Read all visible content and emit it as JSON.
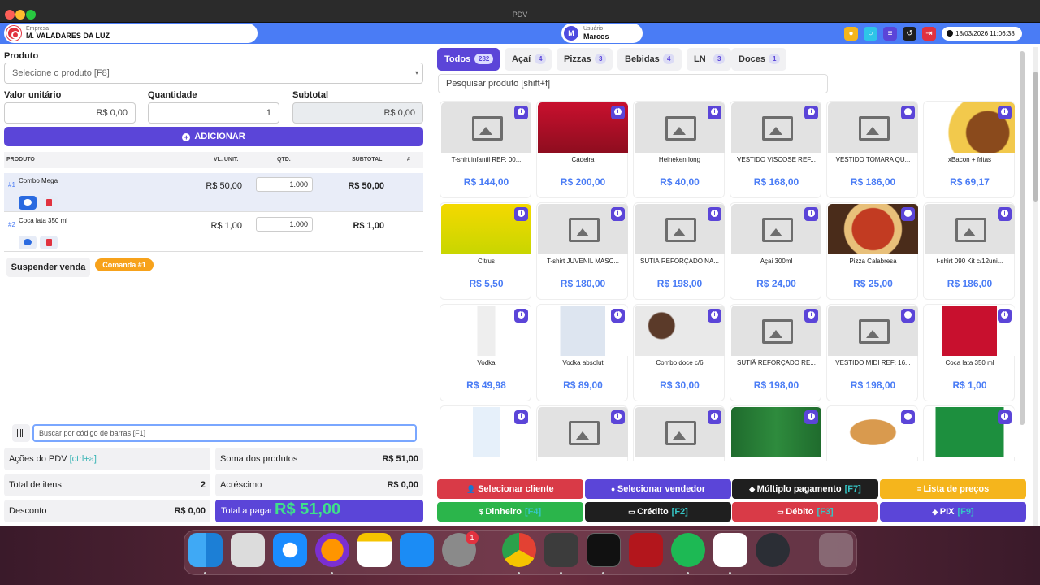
{
  "window": {
    "title": "PDV"
  },
  "header": {
    "empresa_label": "Empresa",
    "empresa_name": "M. VALADARES DA LUZ",
    "usuario_label": "Usuário",
    "usuario_name": "Marcos",
    "usuario_initial": "M",
    "datetime": "18/03/2026 11:06:38"
  },
  "form": {
    "produto_label": "Produto",
    "produto_placeholder": "Selecione o produto [F8]",
    "valor_label": "Valor unitário",
    "valor_value": "R$ 0,00",
    "qtd_label": "Quantidade",
    "qtd_value": "1",
    "subtotal_label": "Subtotal",
    "subtotal_value": "R$ 0,00",
    "add_label": "ADICIONAR"
  },
  "table": {
    "headers": [
      "PRODUTO",
      "VL. UNIT.",
      "QTD.",
      "SUBTOTAL",
      "#"
    ],
    "rows": [
      {
        "num": "#1",
        "name": "Combo Mega",
        "price": "R$ 50,00",
        "qty": "1.000",
        "subtotal": "R$ 50,00"
      },
      {
        "num": "#2",
        "name": "Coca lata 350 ml",
        "price": "R$ 1,00",
        "qty": "1.000",
        "subtotal": "R$ 1,00"
      }
    ]
  },
  "suspend_label": "Suspender venda",
  "comanda_label": "Comanda #1",
  "barcode_placeholder": "Buscar por código de barras [F1]",
  "summary": {
    "acoes_label": "Ações do PDV",
    "acoes_hotkey": "[ctrl+a]",
    "soma_label": "Soma dos produtos",
    "soma_value": "R$ 51,00",
    "itens_label": "Total de itens",
    "itens_value": "2",
    "acrescimo_label": "Acréscimo",
    "acrescimo_value": "R$ 0,00",
    "desconto_label": "Desconto",
    "desconto_value": "R$ 0,00",
    "pagar_label": "Total a pagar",
    "pagar_value": "R$ 51,00"
  },
  "tabs": [
    {
      "label": "Todos",
      "count": "282"
    },
    {
      "label": "Açaí",
      "count": "4"
    },
    {
      "label": "Pizzas",
      "count": "3"
    },
    {
      "label": "Bebidas",
      "count": "4"
    },
    {
      "label": "LN",
      "count": "3"
    },
    {
      "label": "Doces",
      "count": "1"
    }
  ],
  "search_placeholder": "Pesquisar produto [shift+f]",
  "products": [
    {
      "name": "T-shirt infantil REF: 00...",
      "price": "R$ 144,00",
      "img": "placeholder"
    },
    {
      "name": "Cadeira",
      "price": "R$ 200,00",
      "img": "budweiser"
    },
    {
      "name": "Heineken long",
      "price": "R$ 40,00",
      "img": "placeholder"
    },
    {
      "name": "VESTIDO VISCOSE REF...",
      "price": "R$ 168,00",
      "img": "placeholder"
    },
    {
      "name": "VESTIDO TOMARA QU...",
      "price": "R$ 186,00",
      "img": "placeholder"
    },
    {
      "name": "xBacon + fritas",
      "price": "R$ 69,17",
      "img": "burger"
    },
    {
      "name": "Citrus",
      "price": "R$ 5,50",
      "img": "schweppes"
    },
    {
      "name": "T-shirt JUVENIL MASC...",
      "price": "R$ 180,00",
      "img": "placeholder"
    },
    {
      "name": "SUTIÃ REFORÇADO NA...",
      "price": "R$ 198,00",
      "img": "placeholder"
    },
    {
      "name": "Açai 300ml",
      "price": "R$ 24,00",
      "img": "placeholder"
    },
    {
      "name": "Pizza Calabresa",
      "price": "R$ 25,00",
      "img": "pizza"
    },
    {
      "name": "t-shirt 090 Kit c/12uni...",
      "price": "R$ 186,00",
      "img": "placeholder"
    },
    {
      "name": "Vodka",
      "price": "R$ 49,98",
      "img": "vodka"
    },
    {
      "name": "Vodka absolut",
      "price": "R$ 89,00",
      "img": "absolut"
    },
    {
      "name": "Combo doce c/6",
      "price": "R$ 30,00",
      "img": "doces"
    },
    {
      "name": "SUTIÃ REFORÇADO RE...",
      "price": "R$ 198,00",
      "img": "placeholder"
    },
    {
      "name": "VESTIDO MIDI REF: 16...",
      "price": "R$ 198,00",
      "img": "placeholder"
    },
    {
      "name": "Coca lata 350 ml",
      "price": "R$ 1,00",
      "img": "coca"
    },
    {
      "name": "",
      "price": "",
      "img": "water"
    },
    {
      "name": "",
      "price": "",
      "img": "placeholder"
    },
    {
      "name": "",
      "price": "",
      "img": "placeholder"
    },
    {
      "name": "",
      "price": "",
      "img": "heineken"
    },
    {
      "name": "",
      "price": "",
      "img": "sandwich"
    },
    {
      "name": "",
      "price": "",
      "img": "sprite"
    }
  ],
  "actions": [
    {
      "label": "Selecionar cliente",
      "hotkey": "",
      "color": "#d93a47",
      "icon": "user-icon"
    },
    {
      "label": "Selecionar vendedor",
      "hotkey": "",
      "color": "#5b45d8",
      "icon": "user-circle-icon"
    },
    {
      "label": "Múltiplo pagamento",
      "hotkey": "[F7]",
      "color": "#1f1f1f",
      "icon": "tag-icon"
    },
    {
      "label": "Lista de preços",
      "hotkey": "",
      "color": "#f5b51c",
      "icon": "list-icon"
    },
    {
      "label": "Dinheiro",
      "hotkey": "[F4]",
      "color": "#2bb54b",
      "icon": "dollar-icon"
    },
    {
      "label": "Crédito",
      "hotkey": "[F2]",
      "color": "#1f1f1f",
      "icon": "card-icon"
    },
    {
      "label": "Débito",
      "hotkey": "[F3]",
      "color": "#d93a47",
      "icon": "card-icon"
    },
    {
      "label": "PIX",
      "hotkey": "[F9]",
      "color": "#5b45d8",
      "icon": "pix-icon"
    }
  ],
  "dock": {
    "badge": "1"
  }
}
